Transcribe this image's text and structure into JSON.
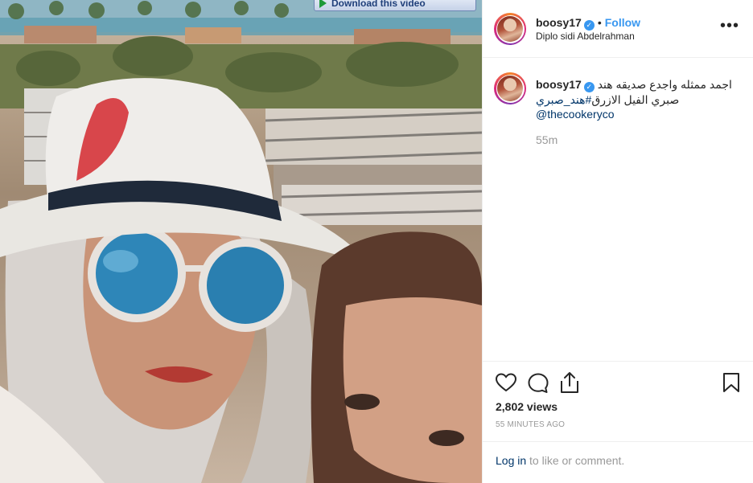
{
  "media": {
    "download_button_label": "Download this video"
  },
  "header": {
    "username": "boosy17",
    "follow_label": "Follow",
    "location": "Diplo sidi Abdelrahman",
    "separator": "•",
    "more_label": "•••"
  },
  "caption": {
    "username": "boosy17",
    "line1": "اجمد ممثله واجدع صديقه هند",
    "line2_text": "صبري الفيل الازرق",
    "hashtag": "#هند_صبري",
    "mention": "@thecookeryco",
    "age": "55m"
  },
  "actions": {
    "views": "2,802 views",
    "posted_ago": "55 MINUTES AGO"
  },
  "login": {
    "link_label": "Log in",
    "rest_text": " to like or comment."
  },
  "icons": {
    "verified": "verified-badge-icon",
    "like": "heart-icon",
    "comment": "comment-bubble-icon",
    "share": "share-icon",
    "save": "bookmark-icon",
    "more": "more-options-icon"
  },
  "colors": {
    "accent_blue": "#3897f0",
    "link_dark_blue": "#003569",
    "muted_gray": "#999999",
    "text": "#262626"
  }
}
